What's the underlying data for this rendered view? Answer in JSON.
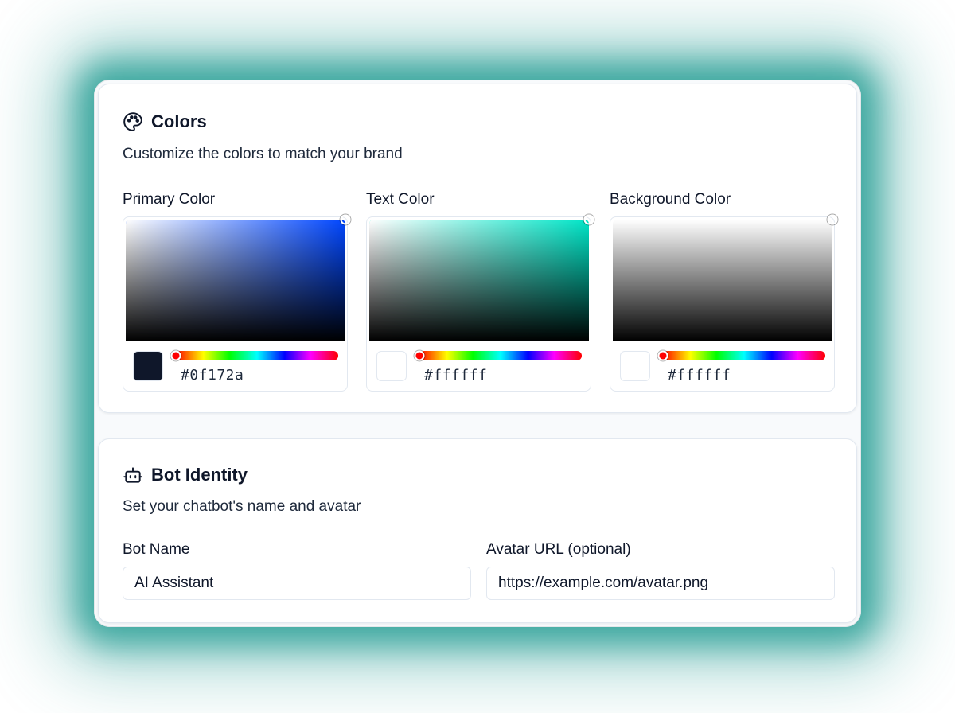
{
  "colors_section": {
    "title": "Colors",
    "subtitle": "Customize the colors to match your brand",
    "icon": "palette-icon",
    "pickers": [
      {
        "label": "Primary Color",
        "hex": "#0f172a",
        "hue_color": "#0046ff",
        "hue_position": 0.0,
        "swatch_color": "#0f172a"
      },
      {
        "label": "Text Color",
        "hex": "#ffffff",
        "hue_color": "#00e6c8",
        "hue_position": 0.0,
        "swatch_color": "#ffffff"
      },
      {
        "label": "Background Color",
        "hex": "#ffffff",
        "hue_color": "#ffffff",
        "hue_position": 0.0,
        "swatch_color": "#ffffff"
      }
    ]
  },
  "identity_section": {
    "title": "Bot Identity",
    "subtitle": "Set your chatbot's name and avatar",
    "icon": "bot-icon",
    "bot_name": {
      "label": "Bot Name",
      "value": "AI Assistant"
    },
    "avatar_url": {
      "label": "Avatar URL (optional)",
      "value": "https://example.com/avatar.png"
    }
  },
  "theme": {
    "accent_glow": "#2ca096",
    "border": "#e2e8f0"
  }
}
